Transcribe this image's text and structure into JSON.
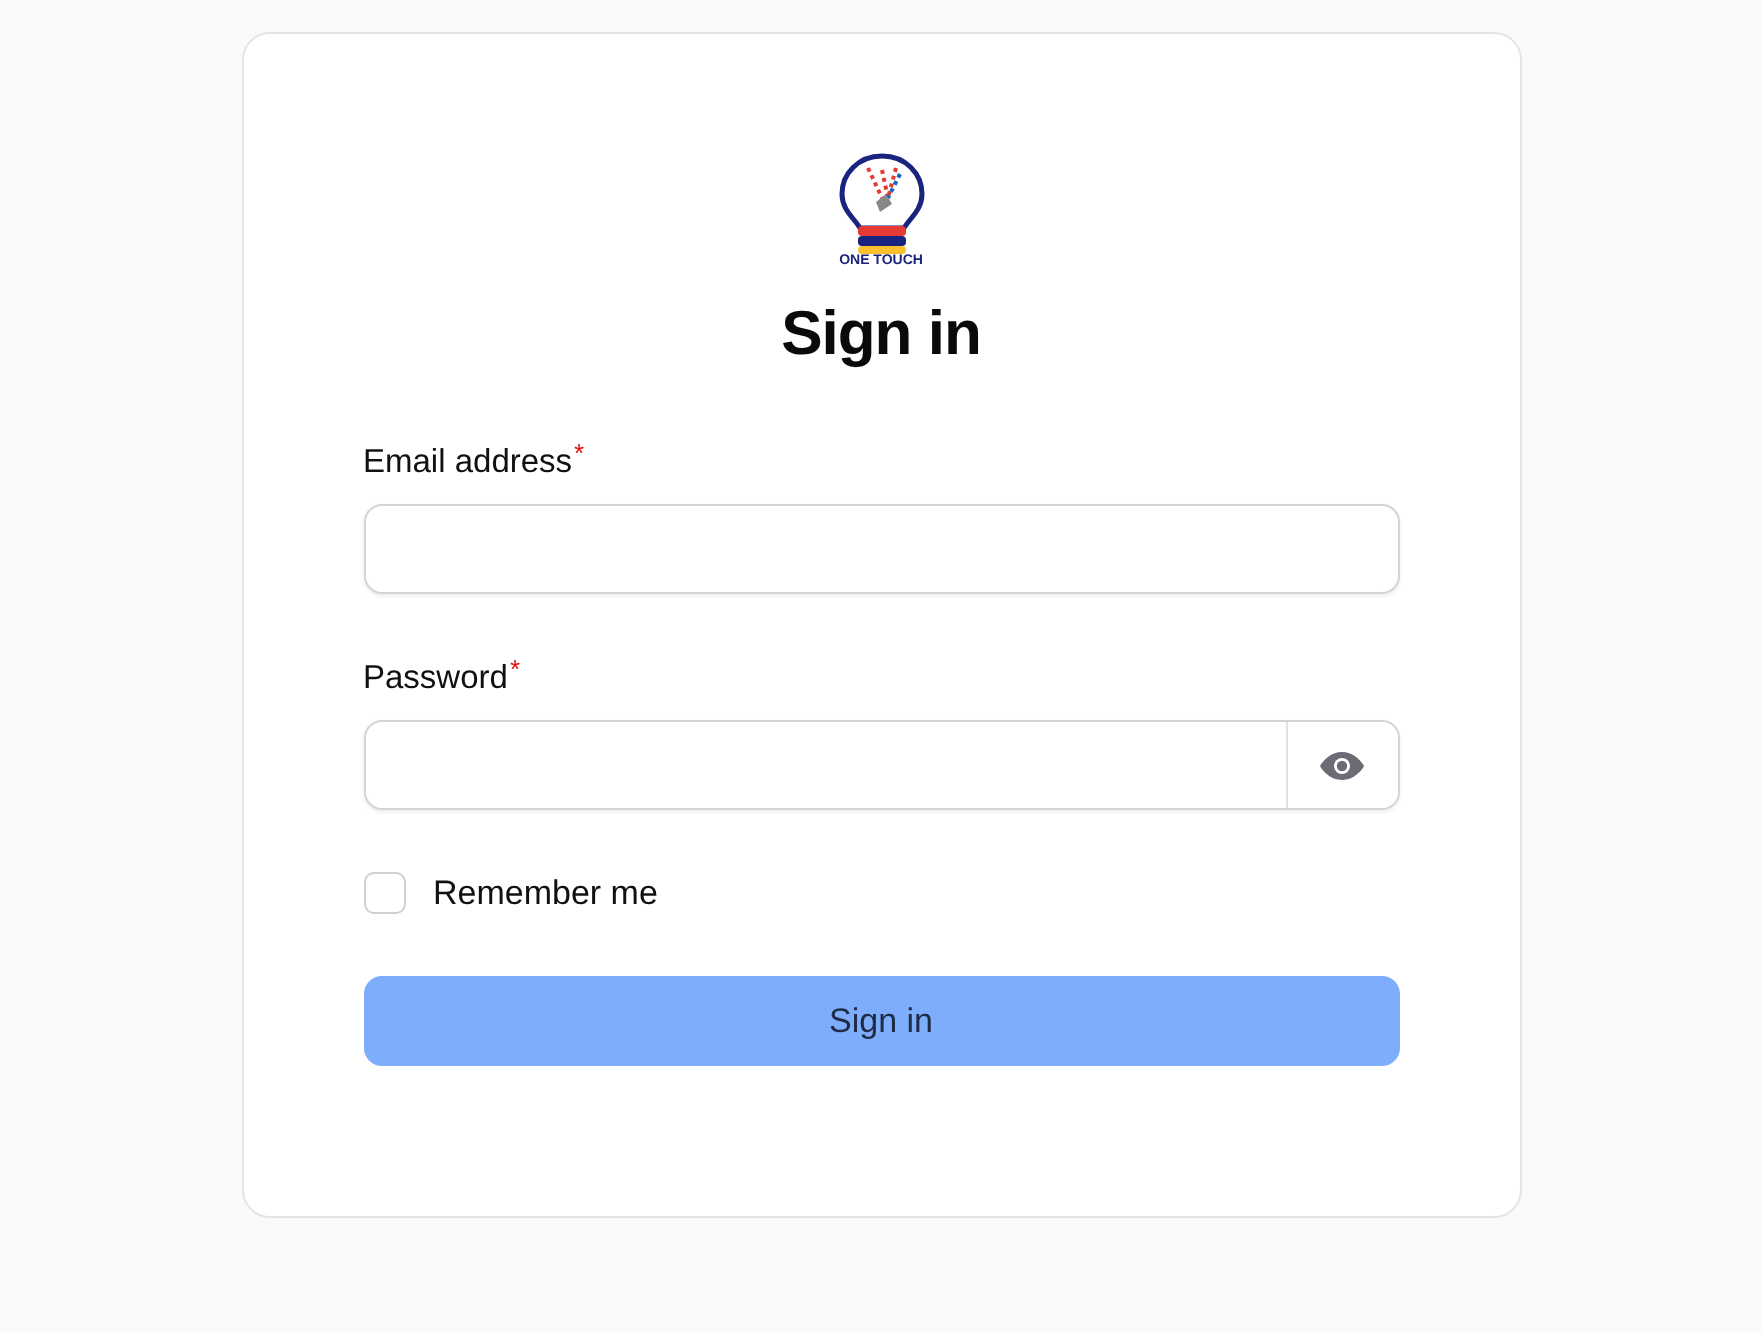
{
  "logo": {
    "caption": "ONE TOUCH"
  },
  "title": "Sign in",
  "fields": [
    {
      "label": "Email address",
      "required_mark": "*",
      "kind": "text"
    },
    {
      "label": "Password",
      "required_mark": "*",
      "kind": "password"
    }
  ],
  "remember": {
    "label": "Remember me",
    "checked": false
  },
  "submit": {
    "label": "Sign in"
  }
}
